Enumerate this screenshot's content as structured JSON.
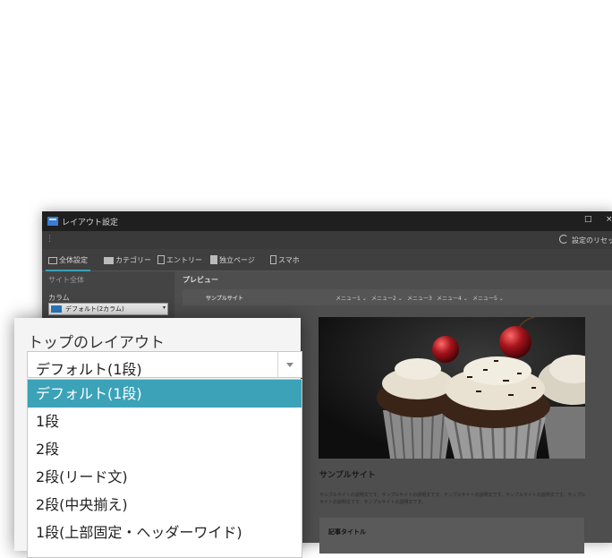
{
  "window": {
    "title": "レイアウト設定",
    "maximize_glyph": "□",
    "close_glyph": "×",
    "toolbar_grip": "⋮",
    "reset_label": "設定のリセット"
  },
  "tabs": [
    {
      "label": "全体設定",
      "icon": "monitor-icon"
    },
    {
      "label": "カテゴリー",
      "icon": "folder-icon"
    },
    {
      "label": "エントリー",
      "icon": "document-icon"
    },
    {
      "label": "独立ページ",
      "icon": "page-icon"
    },
    {
      "label": "スマホ",
      "icon": "phone-icon"
    }
  ],
  "left": {
    "section": "サイト全体",
    "column_label": "カラム",
    "column_value": "デフォルト(2カラム)",
    "dropdown_glyph": "▾"
  },
  "preview": {
    "label": "プレビュー",
    "site_name": "サンプルサイト",
    "menus": [
      "メニュー1 ⌄",
      "メニュー2 ⌄",
      "メニュー3",
      "メニュー4 ⌄",
      "メニュー5 ⌄"
    ],
    "site_title": "サンプルサイト",
    "description": "サンプルサイトの説明文です。サンプルサイトの説明文です。サンプルサイトの説明文です。サンプルサイトの説明文です。サンプルサイトの説明文です。サンプルサイトの説明文です。",
    "article_title": "記事タイトル"
  },
  "popup": {
    "label": "トップのレイアウト",
    "selected_value": "デフォルト(1段)",
    "options": [
      {
        "label": "デフォルト(1段)",
        "selected": true
      },
      {
        "label": "1段",
        "selected": false
      },
      {
        "label": "2段",
        "selected": false
      },
      {
        "label": "2段(リード文)",
        "selected": false
      },
      {
        "label": "2段(中央揃え)",
        "selected": false
      },
      {
        "label": "1段(上部固定・ヘッダーワイド)",
        "selected": false
      }
    ]
  },
  "colors": {
    "accent": "#3ba2b8",
    "titlebar": "#1f1f1f",
    "window_bg": "#4b4b4b"
  }
}
